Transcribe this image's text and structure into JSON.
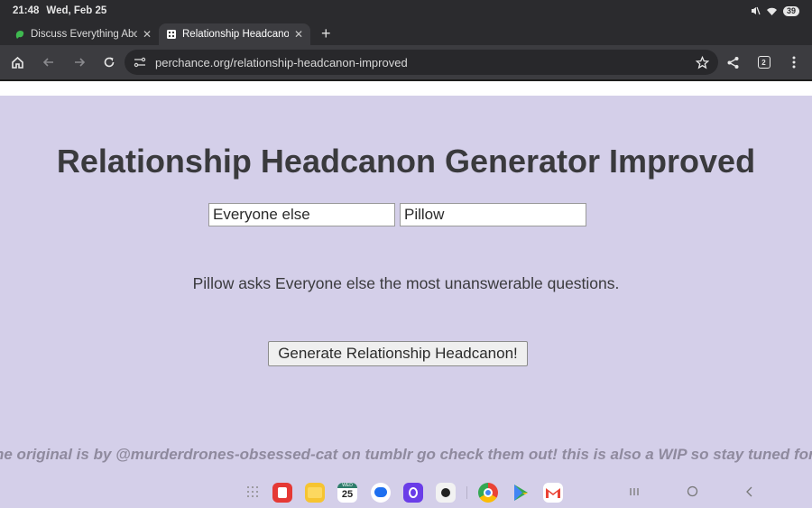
{
  "status": {
    "time": "21:48",
    "date": "Wed, Feb 25",
    "battery": "39"
  },
  "tabs": [
    {
      "label": "Discuss Everything Abou",
      "close": "✕",
      "active": false
    },
    {
      "label": "Relationship Headcanon",
      "close": "✕",
      "active": true
    }
  ],
  "newtab": "+",
  "toolbar": {
    "url": "perchance.org/relationship-headcanon-improved",
    "tab_count": "2"
  },
  "page": {
    "title": "Relationship Headcanon Generator Improved",
    "input1": "Everyone else",
    "input2": "Pillow",
    "result": "Pillow asks Everyone else the most unanswerable questions.",
    "button": "Generate Relationship Headcanon!",
    "footer": "he original is by @murderdrones-obsessed-cat on tumblr go check them out! this is also a WIP so stay tuned for more"
  },
  "taskbar": {
    "calendar_day": "25",
    "calendar_month": "WED",
    "apps": [
      "grid-icon",
      "notes-icon",
      "files-icon",
      "calendar-icon",
      "messages-icon",
      "browser-icon",
      "camera-icon",
      "chrome-icon",
      "play-store-icon",
      "gmail-icon"
    ]
  },
  "colors": {
    "page_bg": "#d4cfe9",
    "chrome_dark": "#2b2b2e",
    "toolbar": "#3c3c40"
  }
}
